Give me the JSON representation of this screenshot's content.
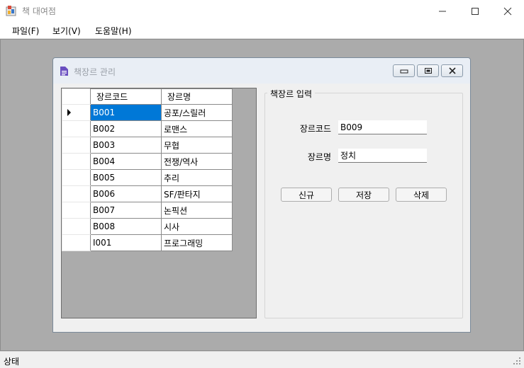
{
  "window": {
    "title": "책 대여점"
  },
  "menu": [
    {
      "label": "파일(F)"
    },
    {
      "label": "보기(V)"
    },
    {
      "label": "도움말(H)"
    }
  ],
  "child": {
    "title": "책장르 관리"
  },
  "grid": {
    "columns": [
      "장르코드",
      "장르명"
    ],
    "rows": [
      {
        "code": "B001",
        "name": "공포/스릴러"
      },
      {
        "code": "B002",
        "name": "로맨스"
      },
      {
        "code": "B003",
        "name": "무협"
      },
      {
        "code": "B004",
        "name": "전쟁/역사"
      },
      {
        "code": "B005",
        "name": "추리"
      },
      {
        "code": "B006",
        "name": "SF/판타지"
      },
      {
        "code": "B007",
        "name": "논픽션"
      },
      {
        "code": "B008",
        "name": "시사"
      },
      {
        "code": "I001",
        "name": "프로그래밍"
      }
    ]
  },
  "form": {
    "group_title": "책장르 입력",
    "code_label": "장르코드",
    "code_value": "B009",
    "name_label": "장르명",
    "name_value": "정치",
    "new_label": "신규",
    "save_label": "저장",
    "delete_label": "삭제"
  },
  "status": {
    "text": "상태"
  }
}
